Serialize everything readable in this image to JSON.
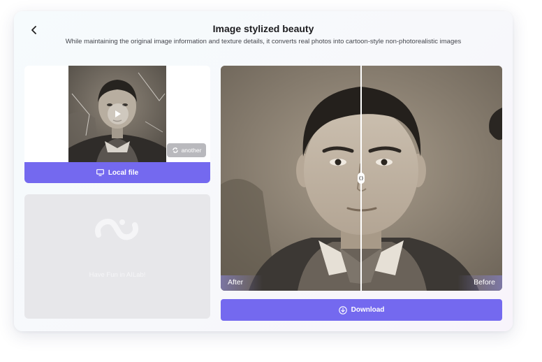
{
  "header": {
    "title": "Image stylized beauty",
    "subtitle": "While maintaining the original image information and texture details, it converts real photos into cartoon-style non-photorealistic images"
  },
  "upload": {
    "another_label": "another",
    "local_file_label": "Local file"
  },
  "promo": {
    "text": "Have Fun in AILab!"
  },
  "compare": {
    "after_label": "After",
    "before_label": "Before"
  },
  "actions": {
    "download_label": "Download"
  },
  "colors": {
    "accent": "#7469ef",
    "card_bg": "#f7f8fb",
    "promo_bg": "#e7e7ea"
  },
  "icons": [
    "back-arrow-icon",
    "play-icon",
    "refresh-icon",
    "monitor-icon",
    "ailab-logo-icon",
    "download-icon",
    "slider-handle-icon"
  ]
}
